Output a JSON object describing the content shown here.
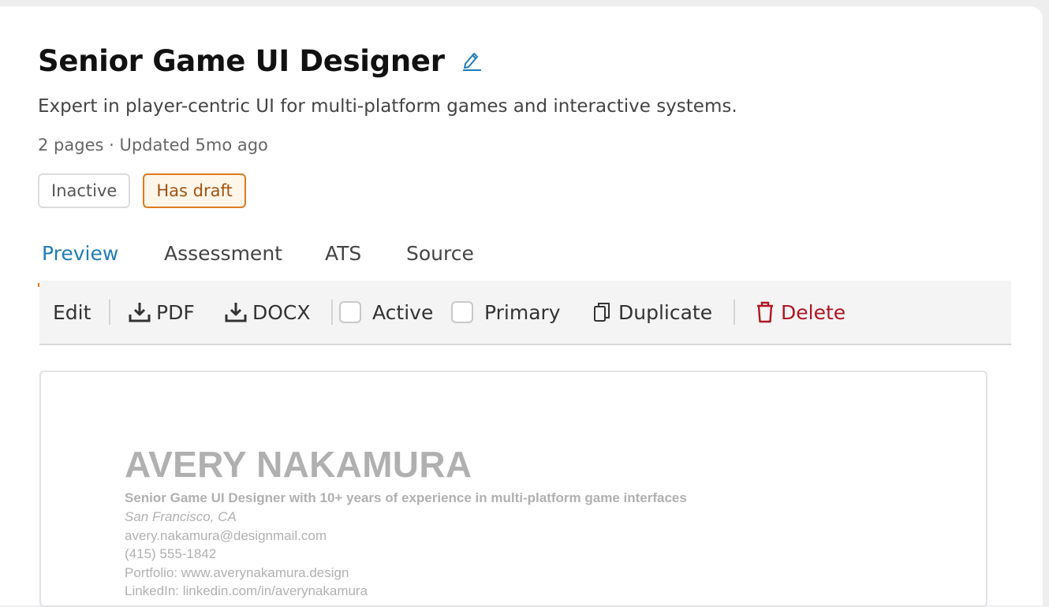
{
  "header": {
    "title": "Senior Game UI Designer",
    "subtitle": "Expert in player-centric UI for multi-platform games and interactive systems.",
    "meta": "2 pages · Updated 5mo ago",
    "badges": [
      "Inactive",
      "Has draft"
    ]
  },
  "tabs": [
    {
      "label": "Preview",
      "active": true
    },
    {
      "label": "Assessment",
      "active": false
    },
    {
      "label": "ATS",
      "active": false
    },
    {
      "label": "Source",
      "active": false
    }
  ],
  "toolbar": {
    "edit": "Edit",
    "pdf": "PDF",
    "docx": "DOCX",
    "active": "Active",
    "active_checked": false,
    "primary": "Primary",
    "primary_checked": false,
    "duplicate": "Duplicate",
    "delete": "Delete"
  },
  "resume": {
    "name": "AVERY NAKAMURA",
    "headline": "Senior Game UI Designer with 10+ years of experience in multi-platform game interfaces",
    "location": "San Francisco, CA",
    "email": "avery.nakamura@designmail.com",
    "phone": "(415) 555-1842",
    "portfolio": "Portfolio: www.averynakamura.design",
    "linkedin": "LinkedIn: linkedin.com/in/averynakamura"
  },
  "colors": {
    "accent_tab": "#1f7eb5",
    "tab_indicator": "#f07d1a",
    "draft_badge": "#e07a1e",
    "delete": "#b01622",
    "edit_icon": "#1f7eb5"
  },
  "icons": {
    "edit_title": "pencil-icon",
    "pdf": "download-icon",
    "docx": "download-icon",
    "duplicate": "copy-icon",
    "delete": "trash-icon"
  }
}
